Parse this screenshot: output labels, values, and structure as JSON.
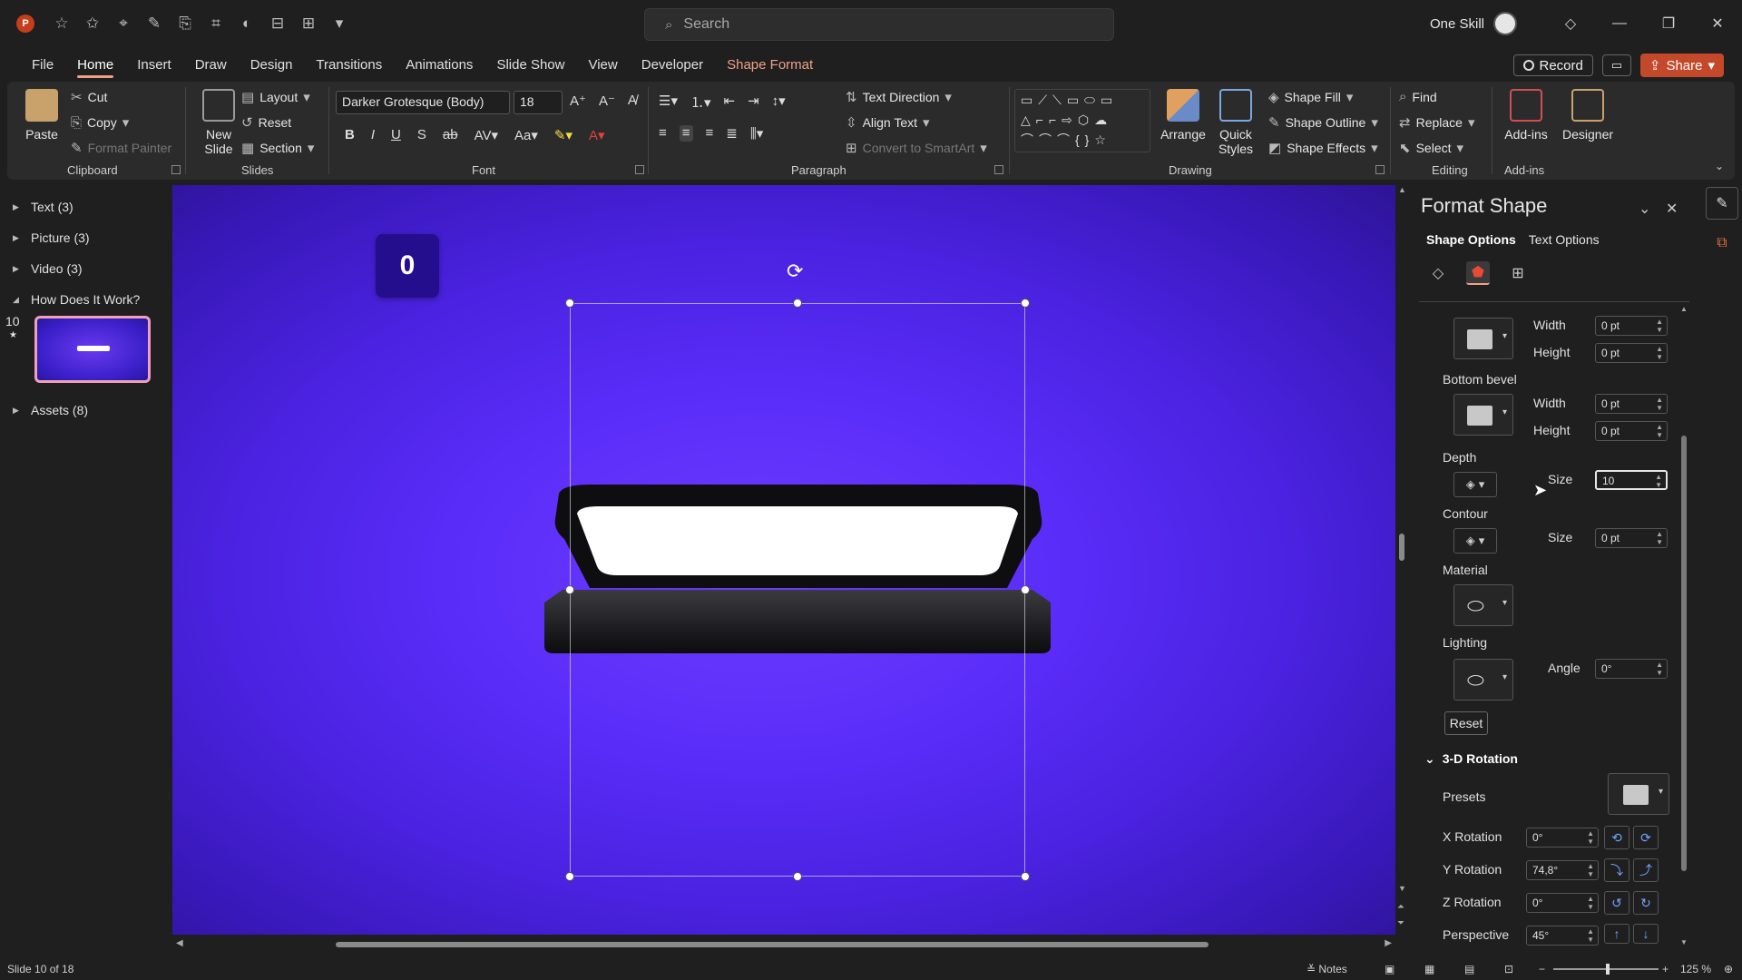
{
  "titlebar": {
    "app_logo": "P",
    "search_placeholder": "Search",
    "user_name": "One Skill",
    "qat_icons": [
      "autosave-icon",
      "star-icon",
      "touch-icon",
      "pen-icon",
      "format-painter-icon",
      "crop-icon",
      "shape-icon",
      "align-icon",
      "distribute-icon",
      "customize-icon"
    ]
  },
  "tabs": [
    "File",
    "Home",
    "Insert",
    "Draw",
    "Design",
    "Transitions",
    "Animations",
    "Slide Show",
    "View",
    "Developer",
    "Shape Format"
  ],
  "active_tab": "Home",
  "tab_actions": {
    "record": "Record",
    "share": "Share"
  },
  "ribbon": {
    "clipboard": {
      "paste": "Paste",
      "cut": "Cut",
      "copy": "Copy",
      "format_painter": "Format Painter",
      "label": "Clipboard"
    },
    "slides": {
      "new_slide": "New Slide",
      "layout": "Layout",
      "reset": "Reset",
      "section": "Section",
      "label": "Slides"
    },
    "font": {
      "font_name": "Darker Grotesque (Body)",
      "font_size": "18",
      "label": "Font"
    },
    "paragraph": {
      "text_direction": "Text Direction",
      "align_text": "Align Text",
      "convert_smartart": "Convert to SmartArt",
      "label": "Paragraph"
    },
    "drawing": {
      "arrange": "Arrange",
      "quick_styles": "Quick Styles",
      "shape_fill": "Shape Fill",
      "shape_outline": "Shape Outline",
      "shape_effects": "Shape Effects",
      "label": "Drawing"
    },
    "editing": {
      "find": "Find",
      "replace": "Replace",
      "select": "Select",
      "label": "Editing"
    },
    "addins": {
      "addins": "Add-ins",
      "designer": "Designer",
      "label": "Add-ins"
    }
  },
  "outline": {
    "sections": [
      {
        "label": "Text (3)"
      },
      {
        "label": "Picture (3)"
      },
      {
        "label": "Video (3)"
      },
      {
        "label": "How Does It Work?"
      },
      {
        "label": "Assets (8)"
      }
    ],
    "slide_number": "10",
    "slide_star": "★"
  },
  "canvas": {
    "counter_value": "0"
  },
  "format_pane": {
    "title": "Format Shape",
    "tabs": [
      "Shape Options",
      "Text Options"
    ],
    "top_bevel": {
      "width_label": "Width",
      "width": "0 pt",
      "height_label": "Height",
      "height": "0 pt"
    },
    "bottom_bevel": {
      "label": "Bottom bevel",
      "width_label": "Width",
      "width": "0 pt",
      "height_label": "Height",
      "height": "0 pt"
    },
    "depth": {
      "label": "Depth",
      "size_label": "Size",
      "size": "10"
    },
    "contour": {
      "label": "Contour",
      "size_label": "Size",
      "size": "0 pt"
    },
    "material": {
      "label": "Material"
    },
    "lighting": {
      "label": "Lighting",
      "angle_label": "Angle",
      "angle": "0°"
    },
    "reset": "Reset",
    "rotation": {
      "header": "3-D Rotation",
      "presets_label": "Presets",
      "x_label": "X Rotation",
      "x": "0°",
      "y_label": "Y Rotation",
      "y": "74,8°",
      "z_label": "Z Rotation",
      "z": "0°",
      "perspective_label": "Perspective",
      "perspective": "45°"
    }
  },
  "status": {
    "slide_info": "Slide 10 of 18",
    "notes": "Notes",
    "zoom": "125 %"
  },
  "colors": {
    "accent": "#f0a088",
    "canvas_center": "#6a3cff",
    "share": "#c4482a",
    "counter_bg": "#250e8e"
  }
}
